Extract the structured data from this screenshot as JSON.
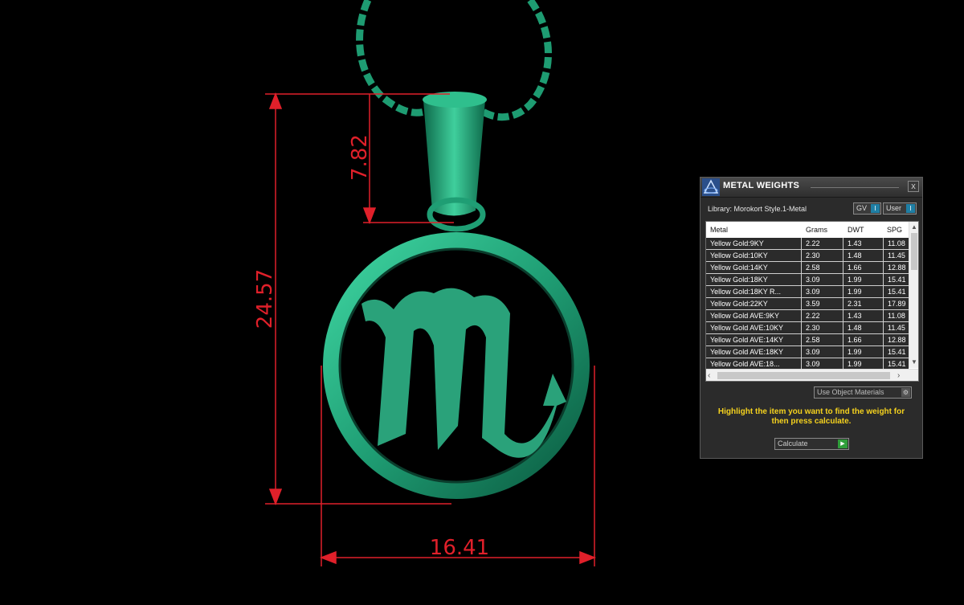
{
  "viewport": {
    "dim_total_height": "24.57",
    "dim_bail_height": "7.82",
    "dim_width": "16.41",
    "colors": {
      "dimension": "#e0202a",
      "pendant": "#2aa27a",
      "background": "#000000"
    }
  },
  "panel": {
    "title": "METAL WEIGHTS",
    "close_label": "x",
    "library": "Library: Morokort Style.1-Metal",
    "gv_label": "GV",
    "user_label": "User",
    "toggle_glyph": "I",
    "columns": [
      "Metal",
      "Grams",
      "DWT",
      "SPG"
    ],
    "rows": [
      {
        "metal": "Yellow Gold:9KY",
        "grams": "2.22",
        "dwt": "1.43",
        "spg": "11.08"
      },
      {
        "metal": "Yellow Gold:10KY",
        "grams": "2.30",
        "dwt": "1.48",
        "spg": "11.45"
      },
      {
        "metal": "Yellow Gold:14KY",
        "grams": "2.58",
        "dwt": "1.66",
        "spg": "12.88"
      },
      {
        "metal": "Yellow Gold:18KY",
        "grams": "3.09",
        "dwt": "1.99",
        "spg": "15.41"
      },
      {
        "metal": "Yellow Gold:18KY R...",
        "grams": "3.09",
        "dwt": "1.99",
        "spg": "15.41"
      },
      {
        "metal": "Yellow Gold:22KY",
        "grams": "3.59",
        "dwt": "2.31",
        "spg": "17.89"
      },
      {
        "metal": "Yellow Gold AVE:9KY",
        "grams": "2.22",
        "dwt": "1.43",
        "spg": "11.08"
      },
      {
        "metal": "Yellow Gold AVE:10KY",
        "grams": "2.30",
        "dwt": "1.48",
        "spg": "11.45"
      },
      {
        "metal": "Yellow Gold AVE:14KY",
        "grams": "2.58",
        "dwt": "1.66",
        "spg": "12.88"
      },
      {
        "metal": "Yellow Gold AVE:18KY",
        "grams": "3.09",
        "dwt": "1.99",
        "spg": "15.41"
      },
      {
        "metal": "Yellow Gold AVE:18...",
        "grams": "3.09",
        "dwt": "1.99",
        "spg": "15.41"
      }
    ],
    "use_object_materials": "Use Object Materials",
    "instruction": "Highlight the item you want to find the weight for then press calculate.",
    "calculate_label": "Calculate",
    "colors": {
      "instruction": "#f5d21e",
      "selection": "#2b2b2b",
      "play": "#2f9e3a",
      "toggle": "#1f7fa5"
    }
  }
}
